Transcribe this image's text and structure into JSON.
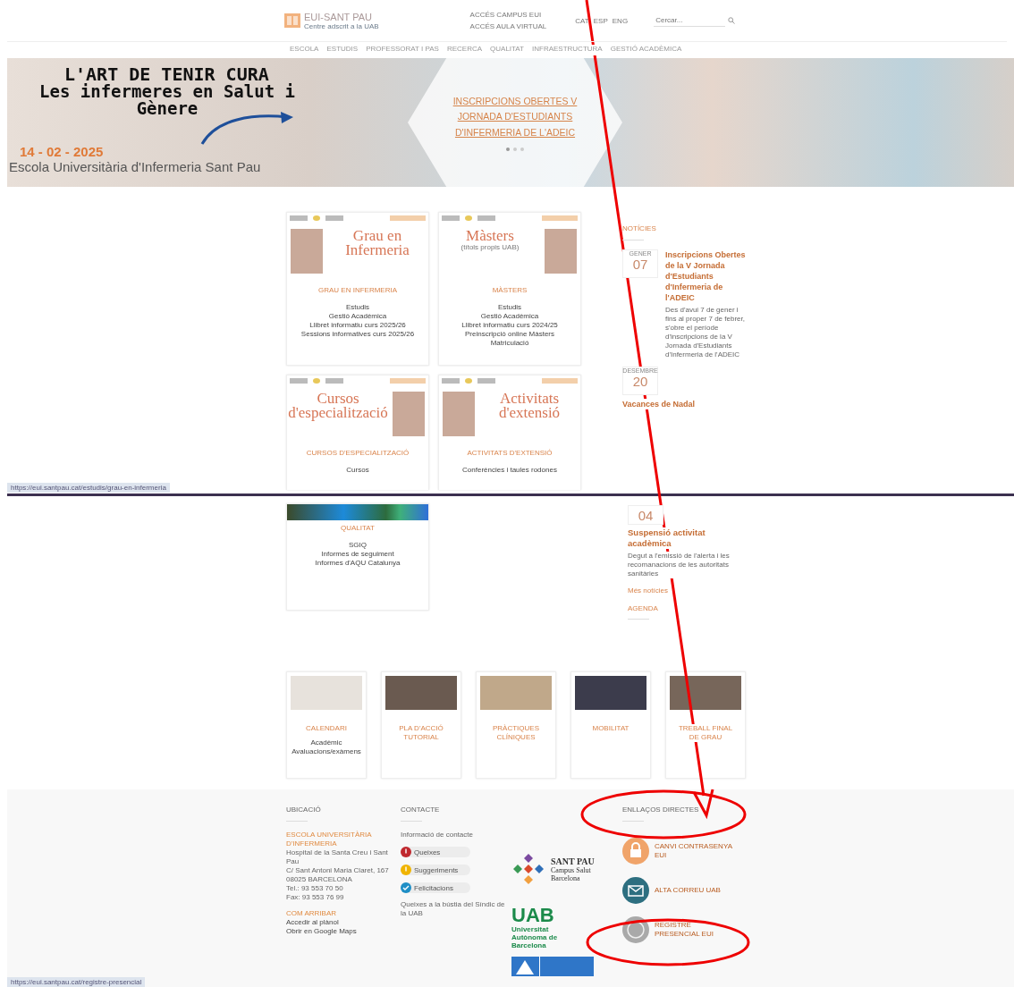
{
  "header": {
    "logo_title": "EUI-SANT PAU",
    "logo_subtitle": "Centre adscrit a la UAB",
    "top_links": [
      "ACCÉS CAMPUS EUI",
      "ACCÉS AULA VIRTUAL"
    ],
    "languages": [
      "CAT",
      "ESP",
      "ENG"
    ],
    "search": {
      "placeholder": "Cercar..."
    }
  },
  "nav": [
    "ESCOLA",
    "ESTUDIS",
    "PROFESSORAT I PAS",
    "RECERCA",
    "QUALITAT",
    "INFRAESTRUCTURA",
    "GESTIÓ ACADÈMICA"
  ],
  "banner": {
    "title": "L'ART DE TENIR CURA",
    "subtitle": "Les infermeres en Salut i Gènere",
    "date": "14 - 02 - 2025",
    "school": "Escola Universitària d'Infermeria Sant Pau",
    "slide_link": "INSCRIPCIONS OBERTES V JORNADA D'ESTUDIANTS D'INFERMERIA DE L'ADEIC",
    "dots": [
      {
        "selected": true
      },
      {
        "selected": false
      },
      {
        "selected": false
      }
    ]
  },
  "programs": [
    {
      "image_title": "Grau en Infermeria",
      "heading": "GRAU EN INFERMERIA",
      "links": [
        "Estudis",
        "Gestió Acadèmica",
        "Llibret informatiu curs 2025/26",
        "Sessions informatives curs 2025/26"
      ]
    },
    {
      "image_title": "Màsters",
      "image_subtitle": "(títols propis UAB)",
      "heading": "MÀSTERS",
      "links": [
        "Estudis",
        "Gestió Acadèmica",
        "Llibret informatiu curs 2024/25",
        "Preinscripció online Màsters",
        "Matriculació"
      ]
    },
    {
      "image_title": "Cursos d'especialització",
      "heading": "CURSOS D'ESPECIALITZACIÓ",
      "links": [
        "Cursos"
      ]
    },
    {
      "image_title": "Activitats d'extensió",
      "heading": "ACTIVITATS D'EXTENSIÓ",
      "links": [
        "Conferències i taules rodones"
      ]
    }
  ],
  "news": {
    "heading": "NOTÍCIES",
    "items": [
      {
        "month": "GENER",
        "day": "07",
        "title": "Inscripcions Obertes de la V Jornada d'Estudiants d'Infermeria de l'ADEIC",
        "text": "Des d'avui 7 de gener i fins al proper 7 de febrer, s'obre el període d'inscripcions de la V Jornada d'Estudiants d'Infermeria de l'ADEIC"
      },
      {
        "month": "DESEMBRE",
        "day": "20",
        "title": "Vacances de Nadal"
      }
    ]
  },
  "status_url_upper": "https://eui.santpau.cat/estudis/grau-en-infermeria",
  "lower": {
    "program": {
      "heading": "QUALITAT",
      "links": [
        "SGIQ",
        "Informes de seguiment",
        "Informes d'AQU Catalunya"
      ]
    },
    "news_item": {
      "day": "04",
      "title": "Suspensió activitat acadèmica",
      "text": "Degut a l'emissió de l'alerta i les recomanacions de les autoritats sanitàries"
    },
    "more_link": "Més notícies",
    "agenda_heading": "AGENDA"
  },
  "services": [
    {
      "heading": "CALENDARI",
      "links": [
        "Acadèmic",
        "Avaluacions/exàmens"
      ]
    },
    {
      "heading": "PLA D'ACCIÓ TUTORIAL"
    },
    {
      "heading": "PRÀCTIQUES CLÍNIQUES"
    },
    {
      "heading": "MOBILITAT"
    },
    {
      "heading": "TREBALL FINAL DE GRAU"
    }
  ],
  "footer": {
    "location": {
      "heading": "UBICACIÓ",
      "name": "ESCOLA UNIVERSITÀRIA D'INFERMERIA",
      "lines": [
        "Hospital de la Santa Creu i Sant Pau",
        "C/ Sant Antoni Maria Claret, 167",
        "08025 BARCELONA",
        "Tel.: 93 553 70 50",
        "Fax: 93 553 76 99"
      ],
      "howto_heading": "COM ARRIBAR",
      "howto_links": [
        "Accedir al plànol",
        "Obrir en Google Maps"
      ]
    },
    "contact": {
      "heading": "CONTACTE",
      "intro": "Informació de contacte",
      "pills": [
        {
          "kind": "complaint",
          "label": "Queixes"
        },
        {
          "kind": "suggestion",
          "label": "Suggeriments"
        },
        {
          "kind": "praise",
          "label": "Felicitacions"
        }
      ],
      "note": "Queixes a la bústia del Síndic de la UAB"
    },
    "partners": {
      "santpau_name": "SANT PAU",
      "santpau_lines": "Campus Salut Barcelona",
      "uab_name": "UAB",
      "uab_lines": "Universitat Autònoma de Barcelona"
    },
    "links": {
      "heading": "ENLLAÇOS DIRECTES",
      "items": [
        {
          "kind": "lock",
          "label": "CANVI CONTRASENYA EUI"
        },
        {
          "kind": "mail",
          "label": "ALTA CORREU UAB"
        },
        {
          "kind": "seal",
          "label": "REGISTRE PRESENCIAL EUI"
        }
      ]
    }
  },
  "status_url_lower": "https://eui.santpau.cat/registre-presencial"
}
